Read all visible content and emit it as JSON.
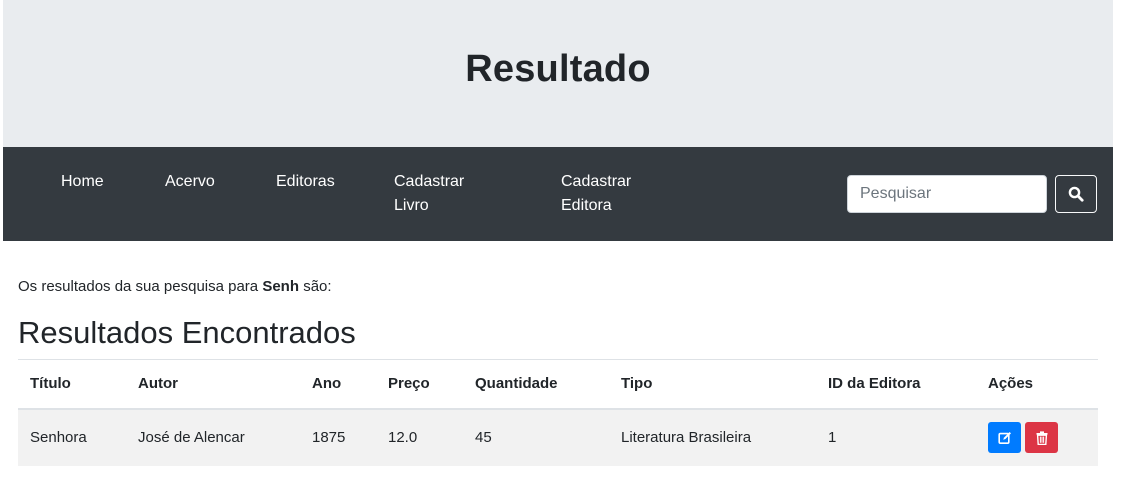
{
  "header": {
    "title": "Resultado"
  },
  "navbar": {
    "items": [
      {
        "label": "Home"
      },
      {
        "label": "Acervo"
      },
      {
        "label": "Editoras"
      },
      {
        "label": "Cadastrar Livro"
      },
      {
        "label": "Cadastrar Editora"
      }
    ],
    "search": {
      "placeholder": "Pesquisar",
      "button_icon": "search-icon"
    }
  },
  "main": {
    "result_prefix": "Os resultados da sua pesquisa para",
    "search_term": "Senh",
    "result_suffix": "são:",
    "section_title": "Resultados Encontrados",
    "table": {
      "columns": [
        "Título",
        "Autor",
        "Ano",
        "Preço",
        "Quantidade",
        "Tipo",
        "ID da Editora",
        "Ações"
      ],
      "rows": [
        {
          "titulo": "Senhora",
          "autor": "José de Alencar",
          "ano": "1875",
          "preco": "12.0",
          "quantidade": "45",
          "tipo": "Literatura Brasileira",
          "id_editora": "1",
          "actions": [
            "edit-icon",
            "trash-icon"
          ]
        }
      ]
    }
  },
  "colors": {
    "jumbotron_bg": "#e9ecef",
    "navbar_bg": "#343a40",
    "edit_button": "#007bff",
    "delete_button": "#dc3545",
    "row_bg": "#f2f2f2"
  }
}
